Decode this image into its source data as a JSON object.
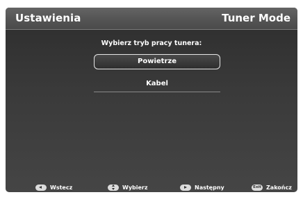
{
  "header": {
    "title": "Ustawienia",
    "mode": "Tuner Mode"
  },
  "prompt": "Wybierz tryb pracy tunera:",
  "options": [
    {
      "label": "Powietrze",
      "selected": true
    },
    {
      "label": "Kabel",
      "selected": false
    }
  ],
  "footer": {
    "hints": [
      {
        "icon": "left-arrow-key-icon",
        "label": "Wstecz"
      },
      {
        "icon": "up-down-key-icon",
        "label": "Wybierz"
      },
      {
        "icon": "right-arrow-key-icon",
        "label": "Następny"
      },
      {
        "icon": "exit-key-icon",
        "key_text": "Exit",
        "label": "Zakończ"
      }
    ]
  },
  "colors": {
    "header": "#555555",
    "background": "#3a3a3a",
    "text": "#ffffff",
    "selection_border": "#e6e6e6"
  }
}
